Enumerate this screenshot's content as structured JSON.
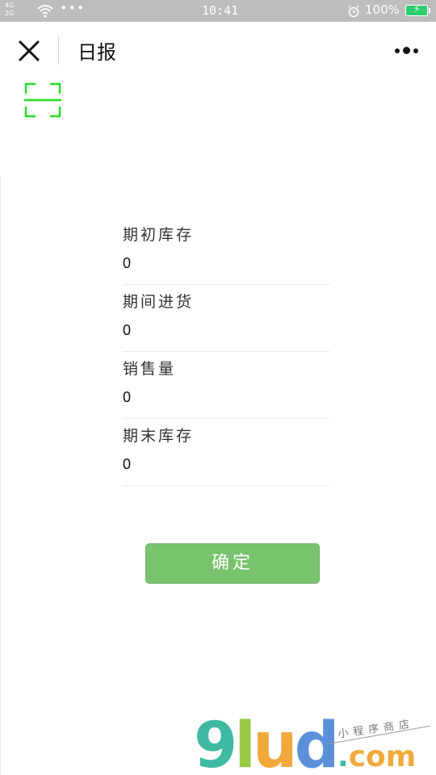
{
  "status_bar": {
    "network_top": "4G",
    "network_bottom": "2G",
    "dots": "•••",
    "time": "10:41",
    "battery_percent": "100%"
  },
  "nav": {
    "title": "日报"
  },
  "form": {
    "fields": [
      {
        "label": "期初库存",
        "value": "0"
      },
      {
        "label": "期间进货",
        "value": "0"
      },
      {
        "label": "销售量",
        "value": "0"
      },
      {
        "label": "期末库存",
        "value": "0"
      }
    ]
  },
  "confirm_button": {
    "label": "确定"
  },
  "watermark": {
    "logo_g": "9",
    "logo_l": "l",
    "logo_u": "u",
    "logo_d": "d",
    "dotcom": "com",
    "tagline": "小程序商店"
  },
  "colors": {
    "accent_green": "#79c36f",
    "scan_green": "#22dd22",
    "status_bar_bg": "#bdbdbd"
  },
  "icons": {
    "close": "close-icon",
    "more": "more-dots-icon",
    "scan": "scan-icon",
    "wifi": "wifi-icon",
    "alarm": "alarm-icon",
    "battery": "battery-icon"
  }
}
